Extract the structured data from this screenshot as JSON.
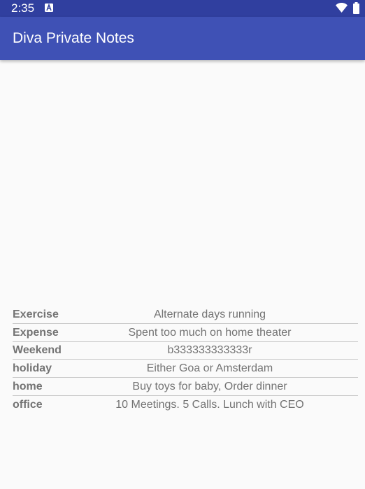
{
  "status_bar": {
    "time": "2:35",
    "notification_icon": "a-letter-icon",
    "wifi_icon": "wifi-icon",
    "battery_icon": "battery-icon",
    "bg_color": "#303f9f"
  },
  "app_bar": {
    "title": "Diva Private Notes",
    "bg_color": "#3f51b5"
  },
  "notes": [
    {
      "title": "Exercise",
      "body": "Alternate days running"
    },
    {
      "title": "Expense",
      "body": "Spent too much on home theater"
    },
    {
      "title": "Weekend",
      "body": "b333333333333r"
    },
    {
      "title": "holiday",
      "body": "Either Goa or Amsterdam"
    },
    {
      "title": "home",
      "body": "Buy toys for baby, Order dinner"
    },
    {
      "title": "office",
      "body": "10 Meetings. 5 Calls. Lunch with CEO"
    }
  ]
}
